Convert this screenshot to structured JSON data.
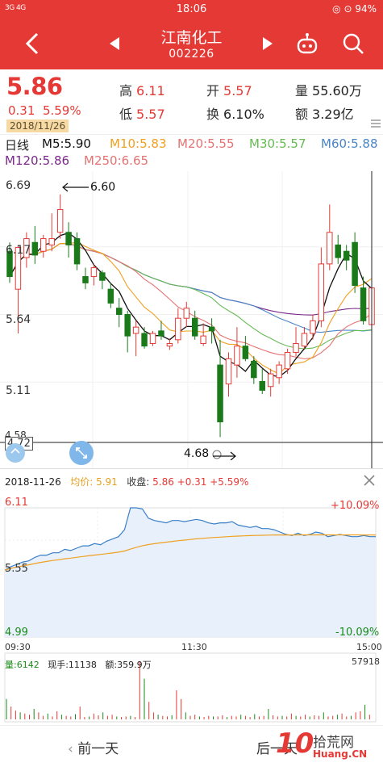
{
  "status": {
    "signal": "3G 4G",
    "time": "18:06",
    "battery": "94%"
  },
  "header": {
    "title": "江南化工",
    "code": "002226"
  },
  "quote": {
    "price": "5.86",
    "change": "0.31",
    "change_pct": "5.59%",
    "date": "2018/11/26",
    "high_label": "高",
    "high": "6.11",
    "open_label": "开",
    "open": "5.57",
    "volume_label": "量",
    "volume": "55.60万",
    "low_label": "低",
    "low": "5.57",
    "turnover_label": "换",
    "turnover": "6.10%",
    "amount_label": "额",
    "amount": "3.29亿"
  },
  "ma": {
    "period": "日线",
    "m5": "M5:5.90",
    "m10": "M10:5.83",
    "m20": "M20:5.55",
    "m30": "M30:5.57",
    "m60": "M60:5.88",
    "m120": "M120:5.86",
    "m250": "M250:6.65",
    "colors": {
      "m5": "#111111",
      "m10": "#f0a020",
      "m20": "#e57373",
      "m30": "#66bb55",
      "m60": "#4a86c5",
      "m120": "#7b2a8a",
      "m250": "#e57373"
    }
  },
  "kline": {
    "y_labels": [
      "6.69",
      "6.17",
      "5.64",
      "5.11",
      "4.72",
      "4.58"
    ],
    "max_annotation": "6.60",
    "min_annotation": "4.68"
  },
  "chart_data": {
    "type": "candlestick",
    "candles": [
      {
        "o": 6.15,
        "h": 6.22,
        "l": 5.9,
        "c": 5.95
      },
      {
        "o": 5.85,
        "h": 6.2,
        "l": 5.5,
        "c": 6.18
      },
      {
        "o": 6.1,
        "h": 6.3,
        "l": 6.02,
        "c": 6.25
      },
      {
        "o": 6.22,
        "h": 6.35,
        "l": 6.05,
        "c": 6.12
      },
      {
        "o": 6.15,
        "h": 6.28,
        "l": 6.1,
        "c": 6.25
      },
      {
        "o": 6.2,
        "h": 6.45,
        "l": 6.15,
        "c": 6.25
      },
      {
        "o": 6.3,
        "h": 6.6,
        "l": 6.25,
        "c": 6.48
      },
      {
        "o": 6.3,
        "h": 6.38,
        "l": 6.1,
        "c": 6.2
      },
      {
        "o": 6.25,
        "h": 6.3,
        "l": 6.0,
        "c": 6.05
      },
      {
        "o": 5.95,
        "h": 6.02,
        "l": 5.85,
        "c": 5.9
      },
      {
        "o": 5.95,
        "h": 6.05,
        "l": 5.88,
        "c": 6.02
      },
      {
        "o": 5.98,
        "h": 6.0,
        "l": 5.85,
        "c": 5.92
      },
      {
        "o": 5.85,
        "h": 5.9,
        "l": 5.7,
        "c": 5.74
      },
      {
        "o": 5.7,
        "h": 5.78,
        "l": 5.55,
        "c": 5.65
      },
      {
        "o": 5.65,
        "h": 5.68,
        "l": 5.35,
        "c": 5.48
      },
      {
        "o": 5.5,
        "h": 5.6,
        "l": 5.32,
        "c": 5.55
      },
      {
        "o": 5.5,
        "h": 5.55,
        "l": 5.38,
        "c": 5.4
      },
      {
        "o": 5.42,
        "h": 5.52,
        "l": 5.4,
        "c": 5.5
      },
      {
        "o": 5.52,
        "h": 5.6,
        "l": 5.45,
        "c": 5.48
      },
      {
        "o": 5.4,
        "h": 5.46,
        "l": 5.37,
        "c": 5.42
      },
      {
        "o": 5.45,
        "h": 5.7,
        "l": 5.42,
        "c": 5.62
      },
      {
        "o": 5.62,
        "h": 5.75,
        "l": 5.55,
        "c": 5.7
      },
      {
        "o": 5.62,
        "h": 5.68,
        "l": 5.45,
        "c": 5.48
      },
      {
        "o": 5.42,
        "h": 5.58,
        "l": 5.4,
        "c": 5.48
      },
      {
        "o": 5.55,
        "h": 5.62,
        "l": 5.42,
        "c": 5.52
      },
      {
        "o": 5.25,
        "h": 5.45,
        "l": 4.68,
        "c": 4.8
      },
      {
        "o": 5.1,
        "h": 5.35,
        "l": 5.0,
        "c": 5.3
      },
      {
        "o": 5.25,
        "h": 5.55,
        "l": 5.15,
        "c": 5.4
      },
      {
        "o": 5.4,
        "h": 5.48,
        "l": 5.28,
        "c": 5.3
      },
      {
        "o": 5.28,
        "h": 5.32,
        "l": 5.1,
        "c": 5.15
      },
      {
        "o": 5.12,
        "h": 5.22,
        "l": 5.02,
        "c": 5.05
      },
      {
        "o": 5.08,
        "h": 5.22,
        "l": 5.0,
        "c": 5.18
      },
      {
        "o": 5.15,
        "h": 5.28,
        "l": 5.1,
        "c": 5.25
      },
      {
        "o": 5.22,
        "h": 5.38,
        "l": 5.18,
        "c": 5.35
      },
      {
        "o": 5.35,
        "h": 5.55,
        "l": 5.32,
        "c": 5.42
      },
      {
        "o": 5.4,
        "h": 5.55,
        "l": 5.38,
        "c": 5.5
      },
      {
        "o": 5.5,
        "h": 5.65,
        "l": 5.45,
        "c": 5.6
      },
      {
        "o": 5.6,
        "h": 6.18,
        "l": 5.55,
        "c": 6.05
      },
      {
        "o": 6.05,
        "h": 6.52,
        "l": 6.0,
        "c": 6.3
      },
      {
        "o": 6.2,
        "h": 6.28,
        "l": 6.05,
        "c": 6.1
      },
      {
        "o": 6.15,
        "h": 6.2,
        "l": 6.0,
        "c": 6.08
      },
      {
        "o": 6.22,
        "h": 6.3,
        "l": 5.82,
        "c": 5.88
      },
      {
        "o": 5.86,
        "h": 5.95,
        "l": 5.57,
        "c": 5.6
      },
      {
        "o": 5.57,
        "h": 6.11,
        "l": 5.57,
        "c": 5.86
      }
    ],
    "ylim": [
      4.58,
      6.72
    ]
  },
  "intraday": {
    "date": "2018-11-26",
    "avg_label": "均价:",
    "avg": "5.91",
    "close_label": "收盘:",
    "close_detail": "5.86 +0.31 +5.59%",
    "price_top": "6.11",
    "price_mid": "5.55",
    "price_bot": "4.99",
    "pct_top": "+10.09%",
    "pct_bot": "-10.09%",
    "t_start": "09:30",
    "t_mid": "11:30",
    "t_end": "15:00",
    "volume_label": "量:6142",
    "hand_label": "现手:11138",
    "amount_label": "额:359.9万",
    "volume_max": "57918"
  },
  "bottom": {
    "prev_day": "前一天",
    "next_day": "后一天"
  },
  "watermark": {
    "num": "10",
    "cn": "拾荒网",
    "en": "Huang.CN"
  }
}
